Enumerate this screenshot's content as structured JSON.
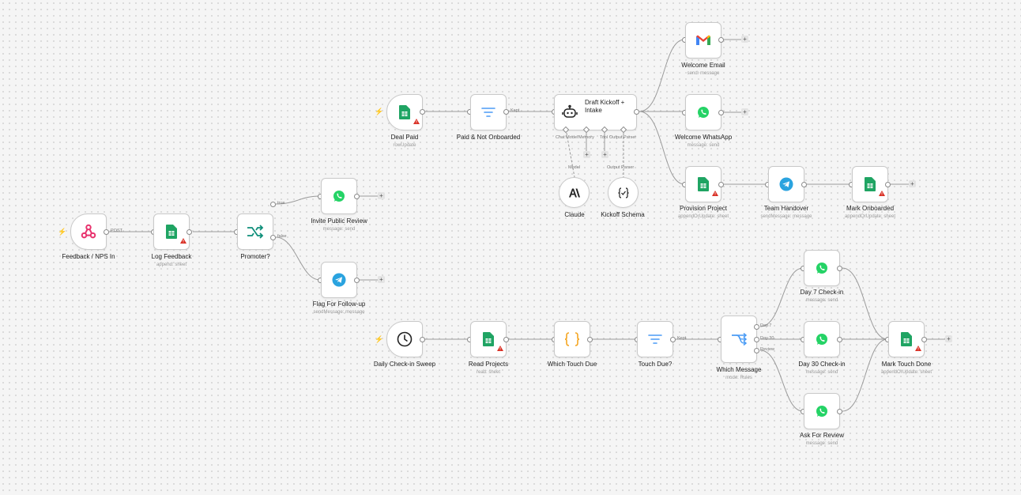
{
  "nodes": {
    "feedback_nps_in": {
      "label": "Feedback / NPS In",
      "icon": "webhook-icon"
    },
    "log_feedback": {
      "label": "Log Feedback",
      "sub": "append: sheet",
      "icon": "google-sheets-icon"
    },
    "promoter": {
      "label": "Promoter?",
      "icon": "if-branch-icon"
    },
    "invite_public_review": {
      "label": "Invite Public Review",
      "sub": "message: send",
      "icon": "whatsapp-icon"
    },
    "flag_follow_up": {
      "label": "Flag For Follow-up",
      "sub": "sendMessage: message",
      "icon": "telegram-icon"
    },
    "deal_paid": {
      "label": "Deal Paid",
      "sub": "rowUpdate",
      "icon": "google-sheets-icon"
    },
    "paid_not_onboarded": {
      "label": "Paid & Not Onboarded",
      "icon": "filter-icon"
    },
    "draft_kickoff": {
      "label": "Draft Kickoff + Intake",
      "icon": "ai-agent-icon"
    },
    "claude": {
      "label": "Claude",
      "icon": "anthropic-icon"
    },
    "kickoff_schema": {
      "label": "Kickoff Schema",
      "icon": "output-parser-icon"
    },
    "welcome_email": {
      "label": "Welcome Email",
      "sub": "send: message",
      "icon": "gmail-icon"
    },
    "welcome_whatsapp": {
      "label": "Welcome WhatsApp",
      "sub": "message: send",
      "icon": "whatsapp-icon"
    },
    "provision_project": {
      "label": "Provision Project",
      "sub": "appendOrUpdate: sheet",
      "icon": "google-sheets-icon"
    },
    "team_handover": {
      "label": "Team Handover",
      "sub": "sendMessage: message",
      "icon": "telegram-icon"
    },
    "mark_onboarded": {
      "label": "Mark Onboarded",
      "sub": "appendOrUpdate: sheet",
      "icon": "google-sheets-icon"
    },
    "daily_checkin_sweep": {
      "label": "Daily Check-in Sweep",
      "icon": "clock-icon"
    },
    "read_projects": {
      "label": "Read Projects",
      "sub": "read: sheet",
      "icon": "google-sheets-icon"
    },
    "which_touch_due": {
      "label": "Which Touch Due",
      "icon": "code-icon"
    },
    "touch_due": {
      "label": "Touch Due?",
      "icon": "filter-icon"
    },
    "which_message": {
      "label": "Which Message",
      "sub": "mode: Rules",
      "icon": "switch-icon"
    },
    "day7_checkin": {
      "label": "Day 7 Check-in",
      "sub": "message: send",
      "icon": "whatsapp-icon"
    },
    "day30_checkin": {
      "label": "Day 30 Check-in",
      "sub": "message: send",
      "icon": "whatsapp-icon"
    },
    "ask_for_review": {
      "label": "Ask For Review",
      "sub": "message: send",
      "icon": "whatsapp-icon"
    },
    "mark_touch_done": {
      "label": "Mark Touch Done",
      "sub": "appendOrUpdate: sheet",
      "icon": "google-sheets-icon"
    }
  },
  "edge_labels": {
    "post": "POST",
    "true": "true",
    "false": "false",
    "kept_1": "Kept",
    "kept_2": "Kept",
    "day7": "Day 7",
    "day30": "Day 30",
    "review": "Review",
    "chat_model": "Chat Model",
    "memory": "Memory",
    "tool": "Tool",
    "output_parser": "Output Parser",
    "model": "Model",
    "output_parser_2": "Output Parser"
  },
  "plus_symbol": "+",
  "trigger_symbol": "⚡",
  "colors": {
    "canvas": "#f5f5f5",
    "edge": "#9a9a9a",
    "sheets_green": "#1fa463",
    "whatsapp_green": "#25d366",
    "telegram_blue": "#2aa3df",
    "webhook_pink": "#e8336e",
    "filter_blue": "#4b9cf5",
    "code_orange": "#f5a623",
    "warning_red": "#d93025",
    "trigger_orange": "#f07a3a"
  }
}
